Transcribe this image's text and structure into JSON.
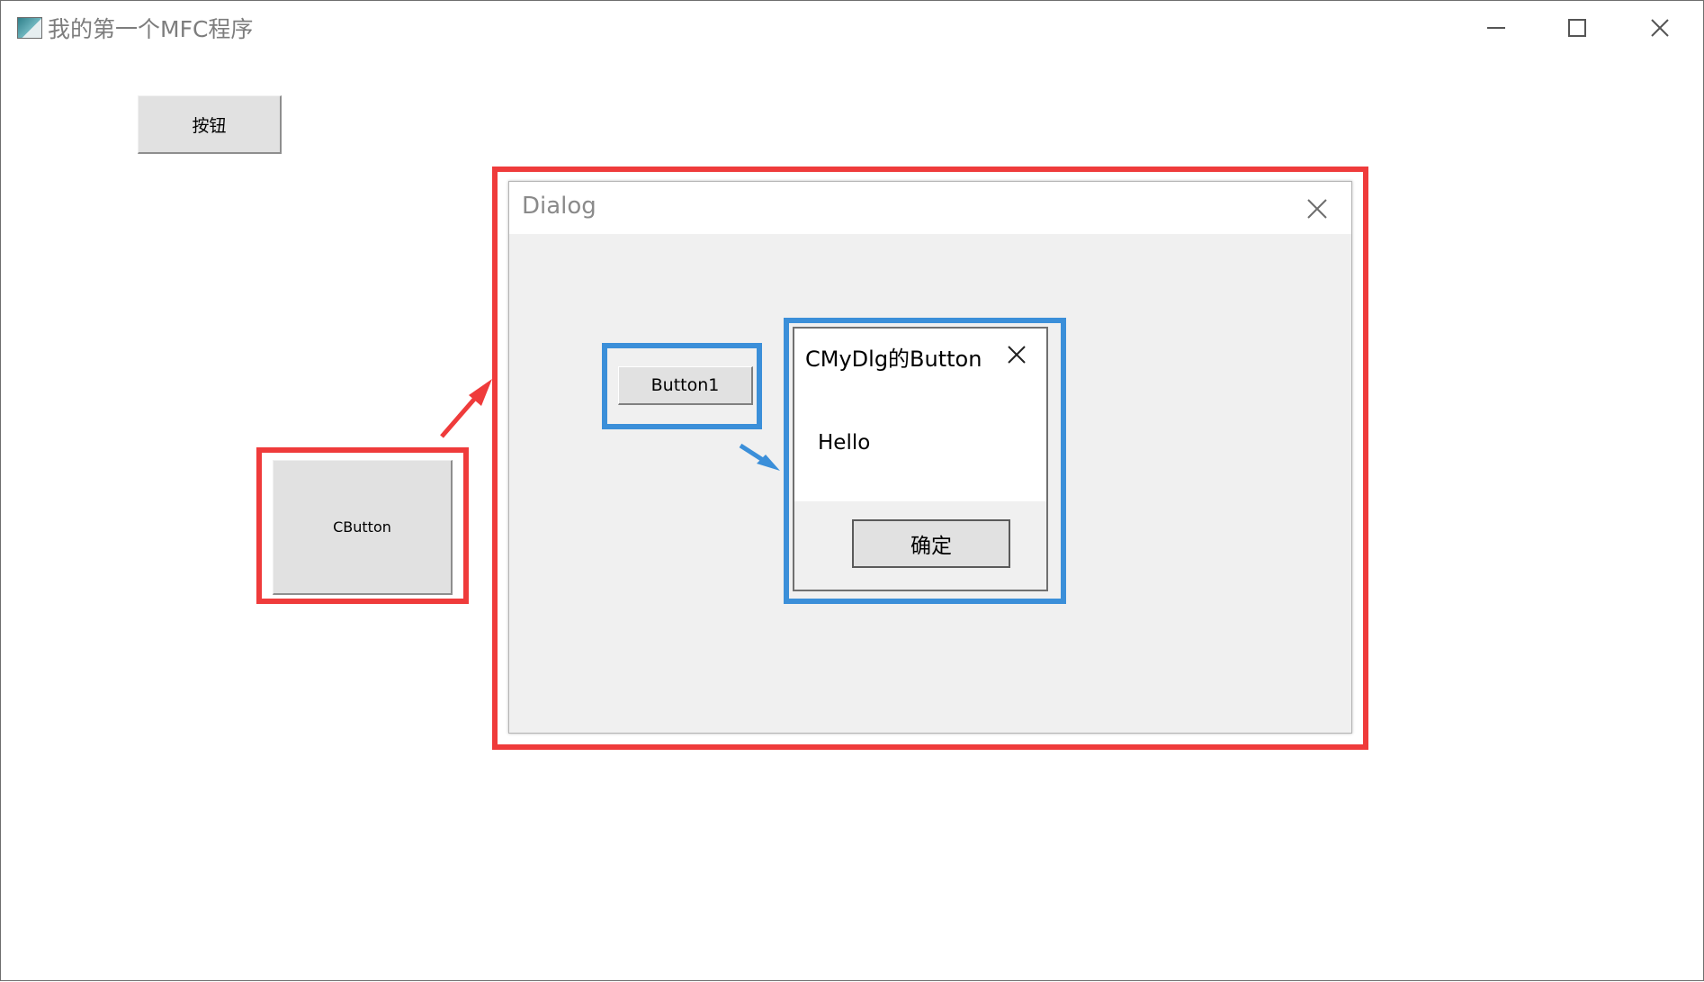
{
  "window": {
    "title": "我的第一个MFC程序",
    "controls": {
      "minimize": "minimize-icon",
      "maximize": "maximize-icon",
      "close": "close-icon"
    }
  },
  "main": {
    "button_label": "按钮",
    "cbutton_label": "CButton"
  },
  "dialog": {
    "title": "Dialog",
    "button1_label": "Button1"
  },
  "message_box": {
    "title": "CMyDlg的Button",
    "text": "Hello",
    "ok_label": "确定"
  },
  "colors": {
    "red_highlight": "#ef3b3b",
    "blue_highlight": "#3b8fd9",
    "dialog_background": "#f0f0f0",
    "button_face": "#e1e1e1"
  }
}
